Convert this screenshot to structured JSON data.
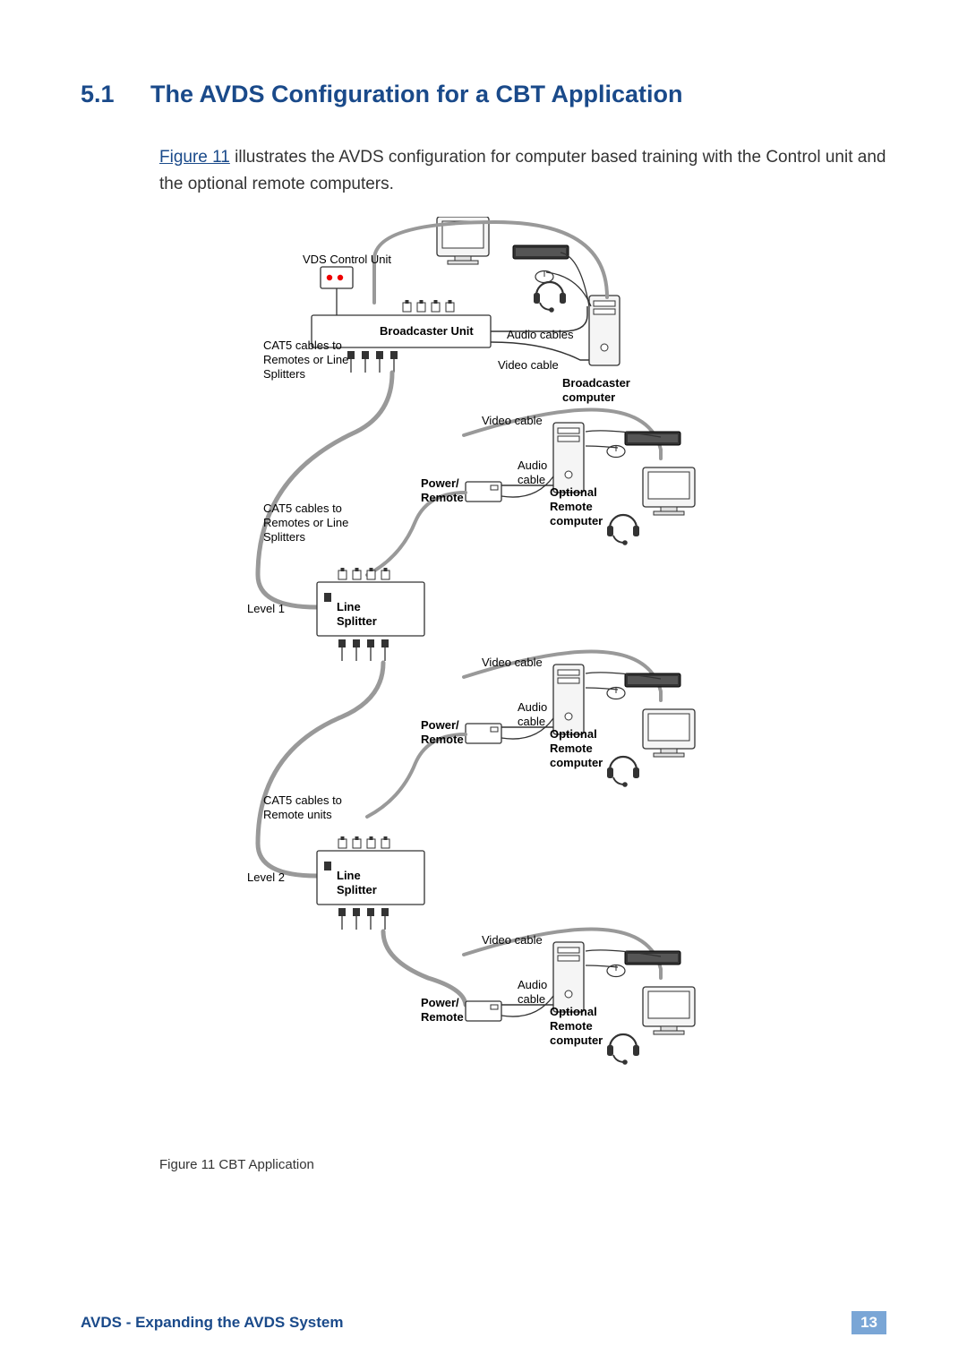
{
  "heading": {
    "number": "5.1",
    "title": "The AVDS Configuration for a CBT Application"
  },
  "para": {
    "figref": "Figure 11",
    "rest": " illustrates the AVDS configuration for computer based training with the Control unit and the optional remote computers."
  },
  "diagram": {
    "vds_control_unit": "VDS Control Unit",
    "broadcaster_unit": "Broadcaster Unit",
    "audio_cables": "Audio cables",
    "video_cable": "Video cable",
    "broadcaster_computer": "Broadcaster\ncomputer",
    "cat5_1": "CAT5 cables to\nRemotes or Line\nSplitters",
    "cat5_2": "CAT5 cables to\nRemotes or Line\nSplitters",
    "cat5_3": "CAT5 cables to\nRemote units",
    "level1": "Level 1",
    "level2": "Level 2",
    "line_splitter": "Line\nSplitter",
    "video_cable_r": "Video cable",
    "audio_cable_r": "Audio\ncable",
    "power_remote": "Power/\nRemote",
    "optional_remote": "Optional\nRemote\ncomputer"
  },
  "caption": "Figure 11 CBT Application",
  "footer": {
    "title": "AVDS - Expanding the AVDS System",
    "page": "13"
  }
}
